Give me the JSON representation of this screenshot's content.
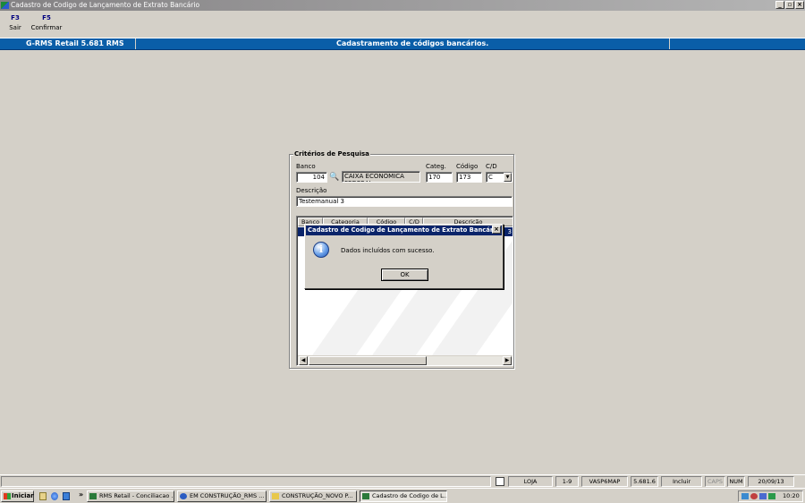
{
  "window": {
    "title": "Cadastro de Codigo de Lançamento de Extrato Bancário",
    "minimize": "_",
    "maximize": "▫",
    "close": "×"
  },
  "toolbar": [
    {
      "key": "F3",
      "label": "Sair"
    },
    {
      "key": "F5",
      "label": "Confirmar"
    }
  ],
  "header": {
    "app": "G-RMS Retail 5.681 RMS",
    "screen": "Cadastramento de códigos bancários."
  },
  "criteria": {
    "title": "Critérios de Pesquisa",
    "banco_label": "Banco",
    "banco_value": "104",
    "banco_name": "CAIXA ECONOMICA FEDERAL",
    "categ_label": "Categ.",
    "categ_value": "170",
    "codigo_label": "Código",
    "codigo_value": "173",
    "cd_label": "C/D",
    "cd_value": "C",
    "descricao_label": "Descrição",
    "descricao_value": "Testemanual 3"
  },
  "list": {
    "columns": [
      "Banco",
      "Categoria",
      "Código",
      "C/D",
      "Descrição"
    ],
    "row_tail": "3"
  },
  "dialog": {
    "title": "Cadastro de Codigo de Lançamento de Extrato Bancário",
    "message": "Dados incluídos  com sucesso.",
    "ok": "OK"
  },
  "status": [
    "LOJA",
    "1-9",
    "VASP6MAP",
    "5.681.6",
    "Incluir",
    "CAPS",
    "NUM",
    "20/09/13"
  ],
  "taskbar": {
    "start": "Iniciar",
    "chevron": "»",
    "tasks": [
      "RMS Retail - Conciliacao ...",
      "EM CONSTRUÇÃO_RMS ...",
      "CONSTRUÇÃO_NOVO P...",
      "Cadastro de Codigo de L..."
    ],
    "clock": "10:20"
  },
  "colors": {
    "header_blue": "#0a5ea8",
    "dialog_title": "#0a246a"
  }
}
